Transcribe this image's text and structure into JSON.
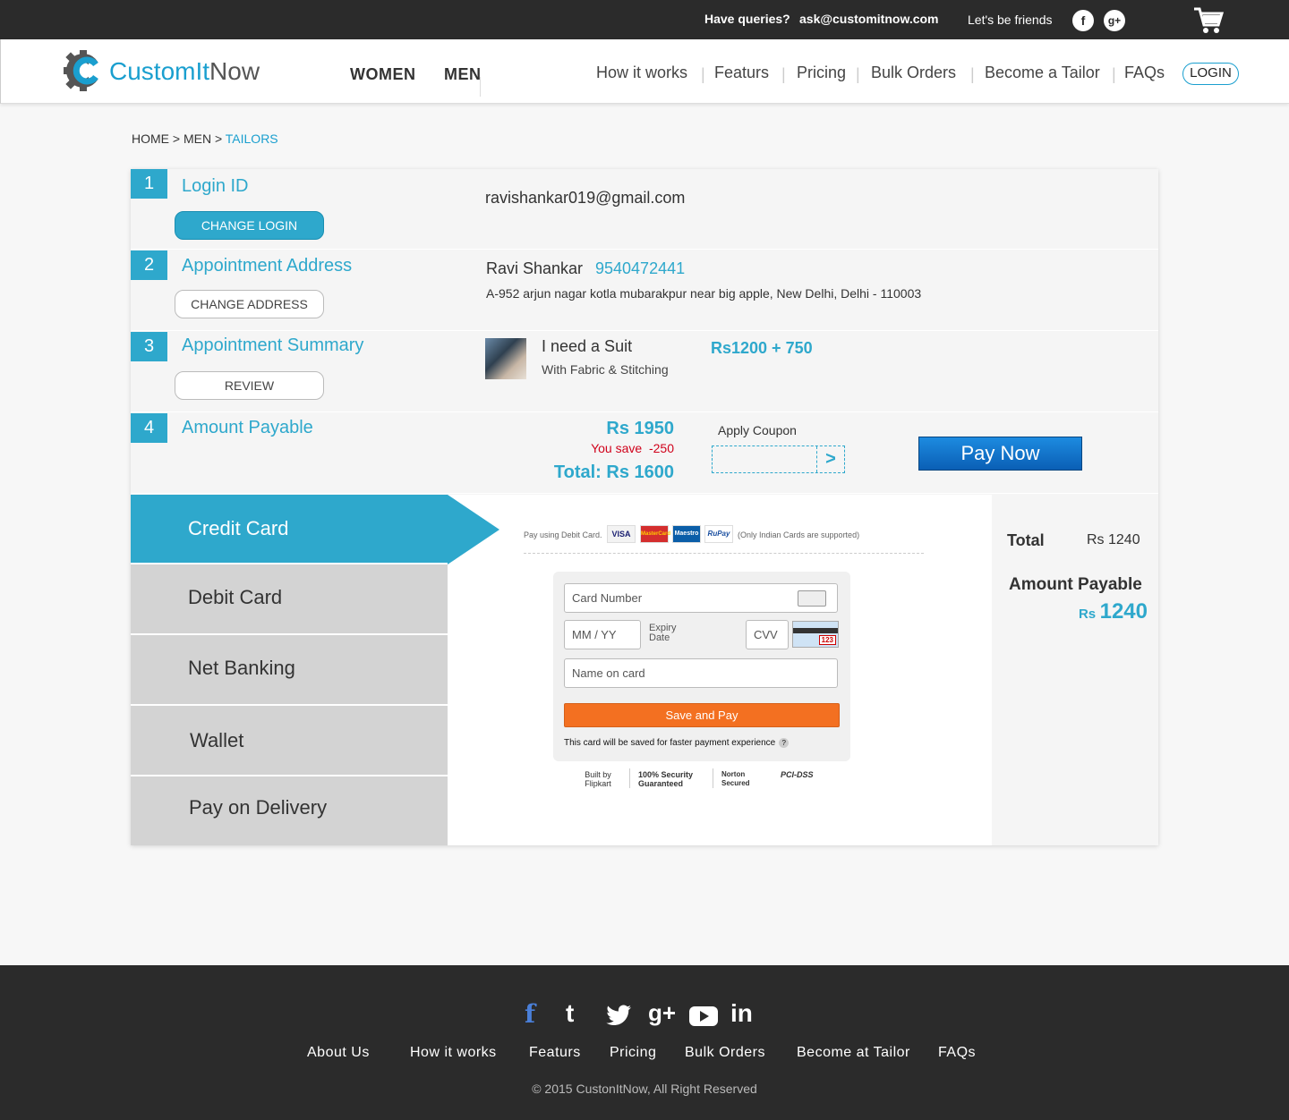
{
  "topbar": {
    "queries_label": "Have queries?",
    "email": "ask@customitnow.com",
    "friends_label": "Let's be friends",
    "facebook_icon": "f",
    "gplus_icon": "g+"
  },
  "header": {
    "logo_custom": "CustomIt",
    "logo_now": "Now",
    "categories": [
      "WOMEN",
      "MEN"
    ],
    "nav": [
      "How it works",
      "Featurs",
      "Pricing",
      "Bulk Orders",
      "Become a Tailor",
      "FAQs"
    ],
    "login": "LOGIN"
  },
  "breadcrumb": {
    "path": "HOME > MEN > ",
    "current": "TAILORS"
  },
  "steps": {
    "login": {
      "num": "1",
      "title": "Login ID",
      "button": "CHANGE LOGIN",
      "email": "ravishankar019@gmail.com"
    },
    "address": {
      "num": "2",
      "title": "Appointment Address",
      "button": "CHANGE ADDRESS",
      "name": "Ravi Shankar",
      "phone": "9540472441",
      "address": "A-952 arjun nagar kotla mubarakpur near big apple, New Delhi, Delhi - 110003"
    },
    "summary": {
      "num": "3",
      "title": "Appointment Summary",
      "button": "REVIEW",
      "item": "I need a Suit",
      "item_sub": "With Fabric  & Stitching",
      "price": "Rs1200  + 750"
    },
    "amount": {
      "num": "4",
      "title": "Amount Payable",
      "amount": "Rs 1950",
      "save_label": "You save",
      "save_value": "-250",
      "total": "Total:  Rs 1600",
      "coupon_label": "Apply Coupon",
      "coupon_go": ">",
      "pay_now": "Pay Now"
    }
  },
  "payment": {
    "methods": [
      "Credit Card",
      "Debit Card",
      "Net Banking",
      "Wallet",
      "Pay on Delivery"
    ],
    "active_method": "Credit Card",
    "card_logos_prefix": "Pay using Debit Card.",
    "card_logos": [
      "VISA",
      "MasterCard",
      "Maestro",
      "RuPay"
    ],
    "card_logos_note": "(Only Indian Cards are supported)",
    "card_number_placeholder": "Card Number",
    "expiry_placeholder": "MM  /  YY",
    "expiry_label": "Expiry Date",
    "cvv_placeholder": "CVV",
    "cvv_sample": "123",
    "name_placeholder": "Name on card",
    "save_pay": "Save and Pay",
    "save_note": "This card will be saved for faster payment experience",
    "help_icon": "?",
    "trust": [
      "Built by Flipkart",
      "100% Security Guaranteed",
      "Norton Secured",
      "PCI-DSS"
    ]
  },
  "order_summary": {
    "total_label": "Total",
    "total_value": "Rs 1240",
    "payable_label": "Amount  Payable",
    "payable_currency": "Rs",
    "payable_value": "1240"
  },
  "footer": {
    "social": [
      "f",
      "t",
      "tw",
      "g+",
      "yt",
      "in"
    ],
    "links": [
      "About Us",
      "How it works",
      "Featurs",
      "Pricing",
      "Bulk Orders",
      "Become at Tailor",
      "FAQs"
    ],
    "copyright": "© 2015 CustonItNow, All Right Reserved"
  },
  "colors": {
    "accent": "#2ea8cc",
    "dark": "#2b2b2b",
    "orange": "#f37021",
    "pay_blue": "#0a5fb5",
    "save_red": "#d0021b"
  }
}
